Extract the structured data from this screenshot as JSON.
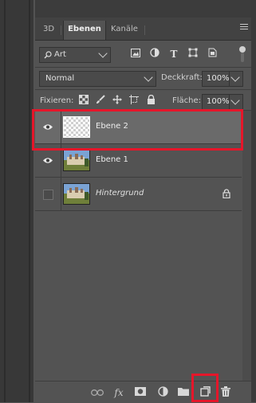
{
  "tabs": [
    {
      "label": "3D",
      "active": false
    },
    {
      "label": "Ebenen",
      "active": true
    },
    {
      "label": "Kanäle",
      "active": false
    }
  ],
  "filter": {
    "kind_label": "Art",
    "filter_icons": [
      "image-filter-icon",
      "adjustment-filter-icon",
      "type-filter-icon",
      "shape-filter-icon",
      "smart-object-filter-icon"
    ],
    "type_glyph": "T"
  },
  "blend": {
    "mode": "Normal",
    "opacity_label": "Deckkraft:",
    "opacity_value": "100%"
  },
  "lock": {
    "label": "Fixieren:",
    "fill_label": "Fläche:",
    "fill_value": "100%"
  },
  "layers": [
    {
      "name": "Ebene 2",
      "visible": true,
      "selected": true,
      "thumbnail": "transparent",
      "locked": false
    },
    {
      "name": "Ebene 1",
      "visible": true,
      "selected": false,
      "thumbnail": "castle-photo",
      "locked": false
    },
    {
      "name": "Hintergrund",
      "visible": false,
      "selected": false,
      "thumbnail": "castle-photo",
      "locked": true
    }
  ],
  "bottom_toolbar": {
    "fx_label": "fx",
    "icons": [
      "link-layers-icon",
      "fx-icon",
      "add-mask-icon",
      "adjustment-layer-icon",
      "new-group-icon",
      "new-layer-icon",
      "delete-layer-icon"
    ]
  },
  "colors": {
    "highlight": "#e5162a",
    "selected_row": "#6a6a6a",
    "panel_bg": "#535353"
  }
}
